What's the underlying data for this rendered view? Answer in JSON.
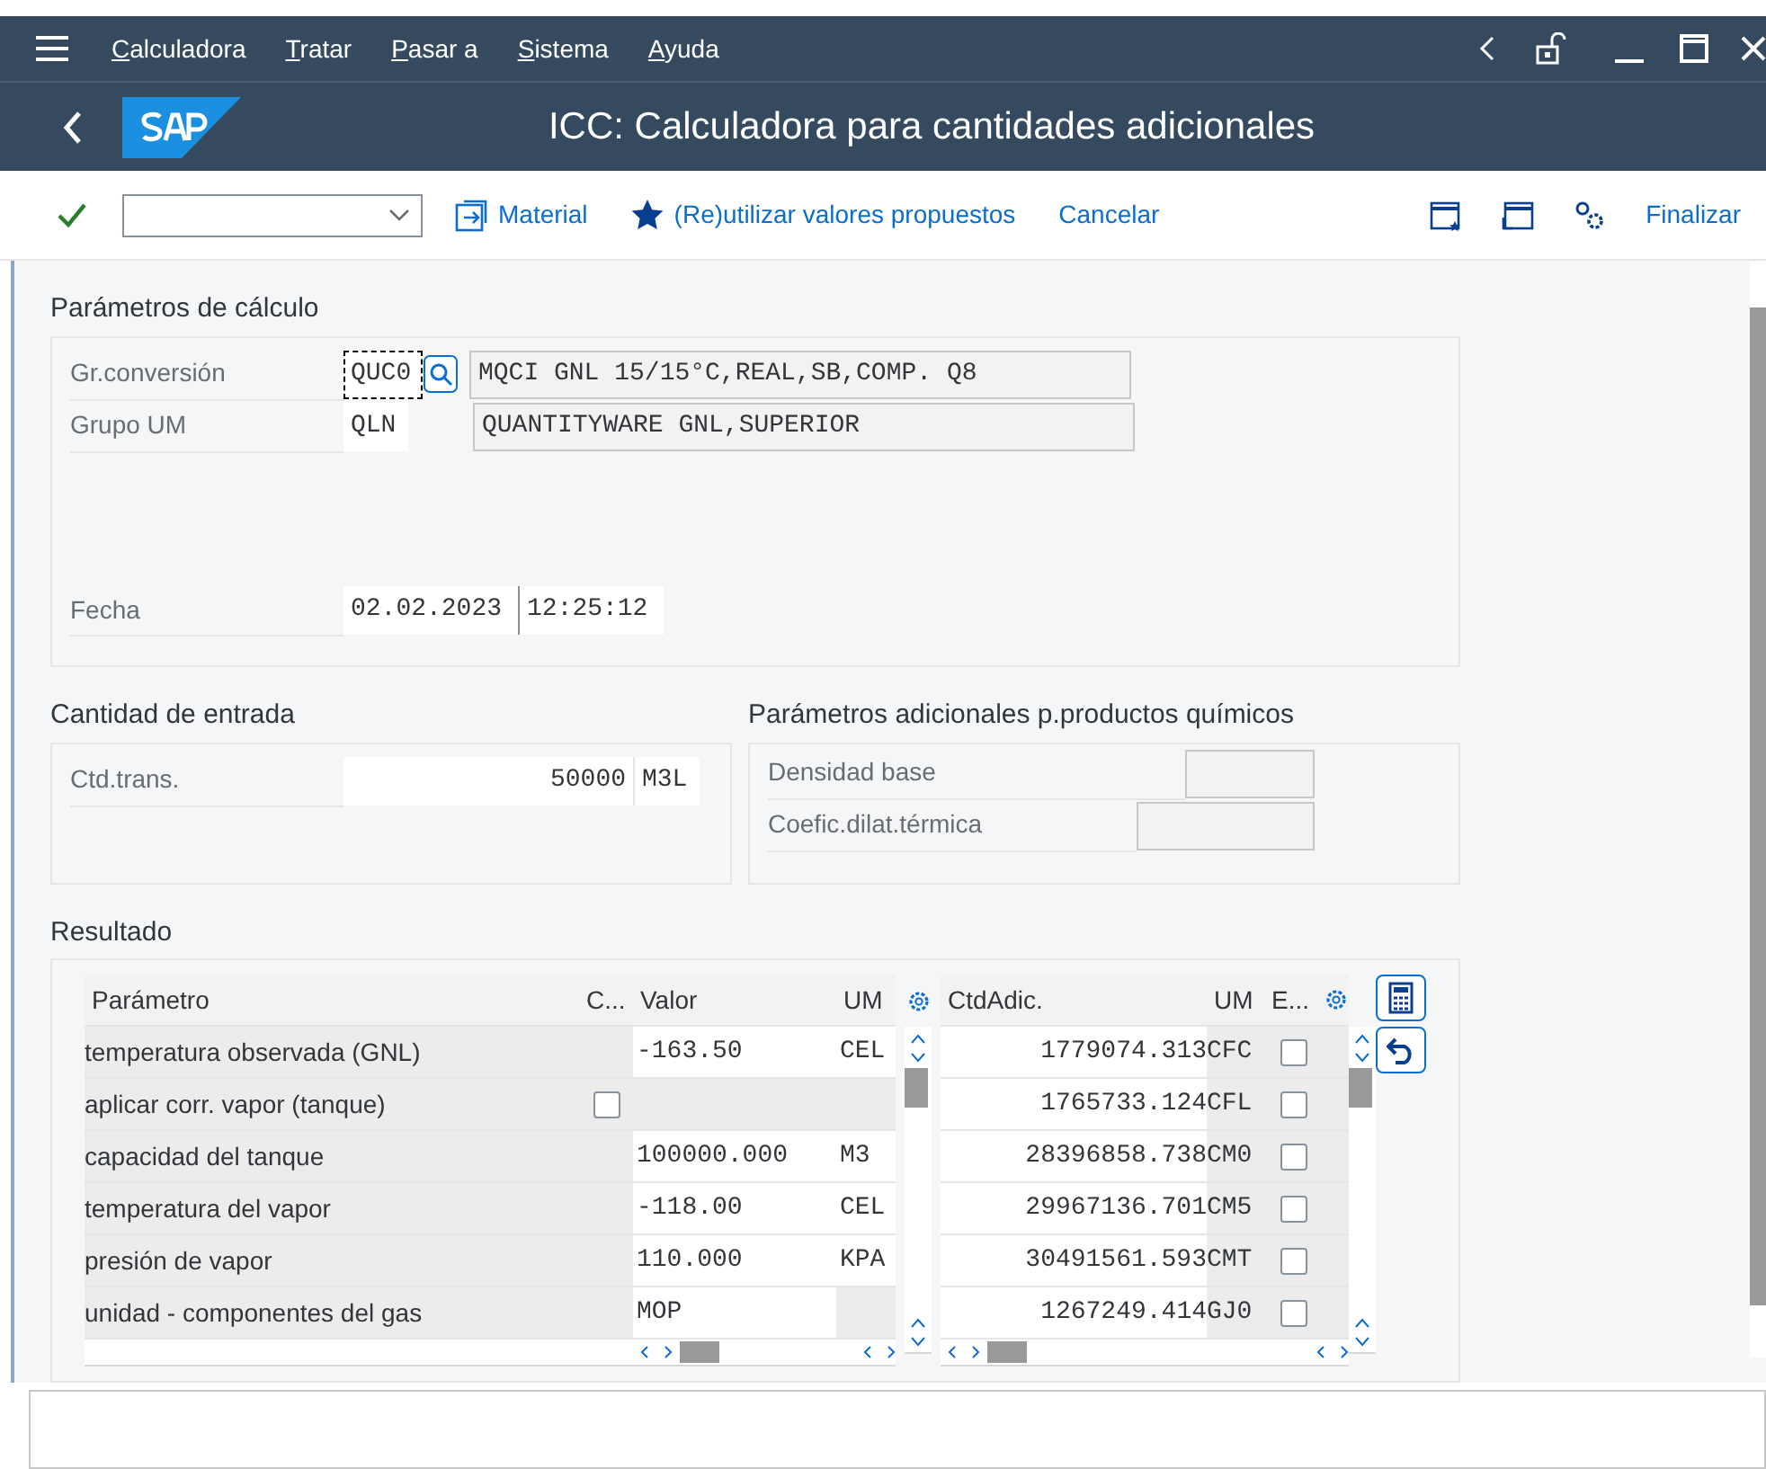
{
  "menu_bar": {
    "items": [
      "Calculadora",
      "Tratar",
      "Pasar a",
      "Sistema",
      "Ayuda"
    ]
  },
  "header": {
    "title": "ICC: Calculadora para cantidades adicionales"
  },
  "toolbar": {
    "items": [
      {
        "kind": "confirm"
      },
      {
        "kind": "dropdown"
      },
      {
        "kind": "material",
        "label": "Material"
      },
      {
        "kind": "favorite",
        "label": "(Re)utilizar valores propuestos"
      },
      {
        "kind": "text",
        "label": "Cancelar"
      }
    ],
    "right_items": [
      {
        "kind": "layout"
      },
      {
        "kind": "window"
      },
      {
        "kind": "settings"
      },
      {
        "kind": "text",
        "label": "Finalizar"
      }
    ]
  },
  "calc_params": {
    "title": "Parámetros de cálculo",
    "conversion": {
      "label": "Gr.conversión",
      "value": "QUC0",
      "focused": true,
      "description": "MQCI GNL 15/15°C,REAL,SB,COMP. Q8"
    },
    "uom_group": {
      "label": "Grupo UM",
      "value": "QLN",
      "description": "QUANTITYWARE GNL,SUPERIOR"
    },
    "date": {
      "label": "Fecha",
      "date": "02.02.2023",
      "time": "12:25:12"
    }
  },
  "input_qty": {
    "title": "Cantidad de entrada",
    "label": "Ctd.trans.",
    "value": "50000",
    "unit": "M3L"
  },
  "chem_params": {
    "title": "Parámetros adicionales p.productos químicos",
    "fields": [
      {
        "label": "Densidad base",
        "disabled": true
      },
      {
        "label": "Coefic.dilat.térmica",
        "disabled": true
      }
    ]
  },
  "results": {
    "title": "Resultado",
    "params_table": {
      "columns": [
        "Parámetro",
        "C...",
        "Valor",
        "UM"
      ],
      "rows": [
        {
          "kind": "value",
          "parameter": "temperatura observada (GNL)",
          "value": "-163.50",
          "unit": "CEL"
        },
        {
          "kind": "checkbox",
          "parameter": "aplicar corr. vapor (tanque)",
          "checked": false
        },
        {
          "kind": "value",
          "parameter": "capacidad del tanque",
          "value": "100000.000",
          "unit": "M3"
        },
        {
          "kind": "value",
          "parameter": "temperatura del vapor",
          "value": "-118.00",
          "unit": "CEL"
        },
        {
          "kind": "value",
          "parameter": "presión de vapor",
          "value": "110.000",
          "unit": "KPA"
        },
        {
          "kind": "value",
          "parameter": "unidad - componentes del gas",
          "value": "MOP"
        }
      ]
    },
    "amounts_table": {
      "columns": [
        "CtdAdic.",
        "UM",
        "E..."
      ],
      "rows": [
        {
          "amount": "1779074.313",
          "unit": "CFC",
          "checked": false
        },
        {
          "amount": "1765733.124",
          "unit": "CFL",
          "checked": false
        },
        {
          "amount": "28396858.738",
          "unit": "CM0",
          "checked": false
        },
        {
          "amount": "29967136.701",
          "unit": "CM5",
          "checked": false
        },
        {
          "amount": "30491561.593",
          "unit": "CMT",
          "checked": false
        },
        {
          "amount": "1267249.414",
          "unit": "GJ0",
          "checked": false
        }
      ]
    }
  }
}
